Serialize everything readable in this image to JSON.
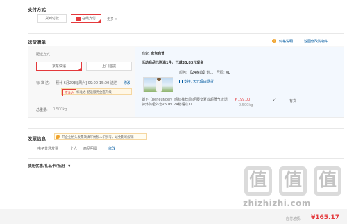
{
  "payment": {
    "title": "支付方式",
    "options": [
      "货到付款",
      "在线支付"
    ],
    "more": "更多 »"
  },
  "delivery": {
    "title": "送货清单",
    "price_note": "价格说明",
    "back_to_cart": "返回修改购物车",
    "method_label": "配送方式",
    "methods": [
      "京东快递",
      "上门自提"
    ],
    "time_label": "标 准 达:",
    "time_value": "预计 6月29日[周六] 09:00-15:00 送达",
    "time_edit": "修改",
    "time_hint_badge": "京准达",
    "time_hint_text": "标准达 配送服务全面升级",
    "weight_label": "总重量:",
    "weight_value": "0.500kg"
  },
  "goods": {
    "seller_label": "商家:",
    "seller_name": "京东自营",
    "promo": "活动商品已购满1件，已减33.83元现金",
    "color_label": "颜色:",
    "color_value": "【24春款】训...",
    "size_label": "尺码:",
    "size_value": "XL",
    "support": "支持7天无理由退货",
    "name": "朗下（beneunder）晴标推荐|防晒服女夏款超薄气流透护外防晒外套AS16024秘语灰XL",
    "price": "¥ 199.00",
    "qty": "x1",
    "stock": "有货",
    "weight": "0.500kg"
  },
  "invoice": {
    "title": "发票信息",
    "notice": "开企业抬头发票须填写纳税人识别号，以免影响报销",
    "type": "电子普通发票",
    "person": "个人",
    "detail": "商品明细",
    "edit": "修改"
  },
  "coupon": {
    "title": "使用优惠/礼品卡/抵用",
    "chevron": "∨"
  },
  "footer": {
    "label": "应付总额:",
    "total": "¥165.17"
  },
  "watermark": {
    "chars": [
      "值",
      "值",
      "值"
    ],
    "site": "zhizhizhi.com"
  },
  "colors": {
    "accent": "#e4393c",
    "link": "#005aa0"
  }
}
